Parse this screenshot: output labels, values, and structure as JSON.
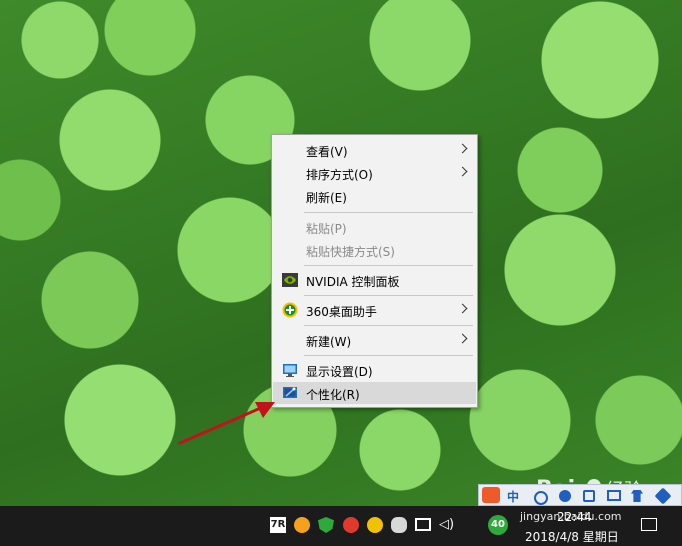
{
  "context_menu": {
    "items": [
      {
        "label": "查看(V)",
        "has_submenu": true
      },
      {
        "label": "排序方式(O)",
        "has_submenu": true
      },
      {
        "label": "刷新(E)"
      },
      {
        "label": "粘贴(P)",
        "disabled": true
      },
      {
        "label": "粘贴快捷方式(S)",
        "disabled": true
      },
      {
        "label": "NVIDIA 控制面板",
        "icon": "nvidia-icon"
      },
      {
        "label": "360桌面助手",
        "icon": "360-assistant-icon",
        "has_submenu": true
      },
      {
        "label": "新建(W)",
        "has_submenu": true
      },
      {
        "label": "显示设置(D)",
        "icon": "display-settings-icon"
      },
      {
        "label": "个性化(R)",
        "icon": "personalize-icon",
        "highlighted": true
      }
    ]
  },
  "taskbar": {
    "tray_badge": "40",
    "ime_label": "中",
    "clock_time": "22:44",
    "clock_date": "2018/4/8 星期日"
  },
  "watermark": {
    "text": "jingyan.baidu.com"
  },
  "colors": {
    "menu_bg": "#f2f2f2",
    "menu_highlight": "#d9d9d9",
    "taskbar_bg": "#1b1b1b",
    "annotation": "#c0141c"
  }
}
